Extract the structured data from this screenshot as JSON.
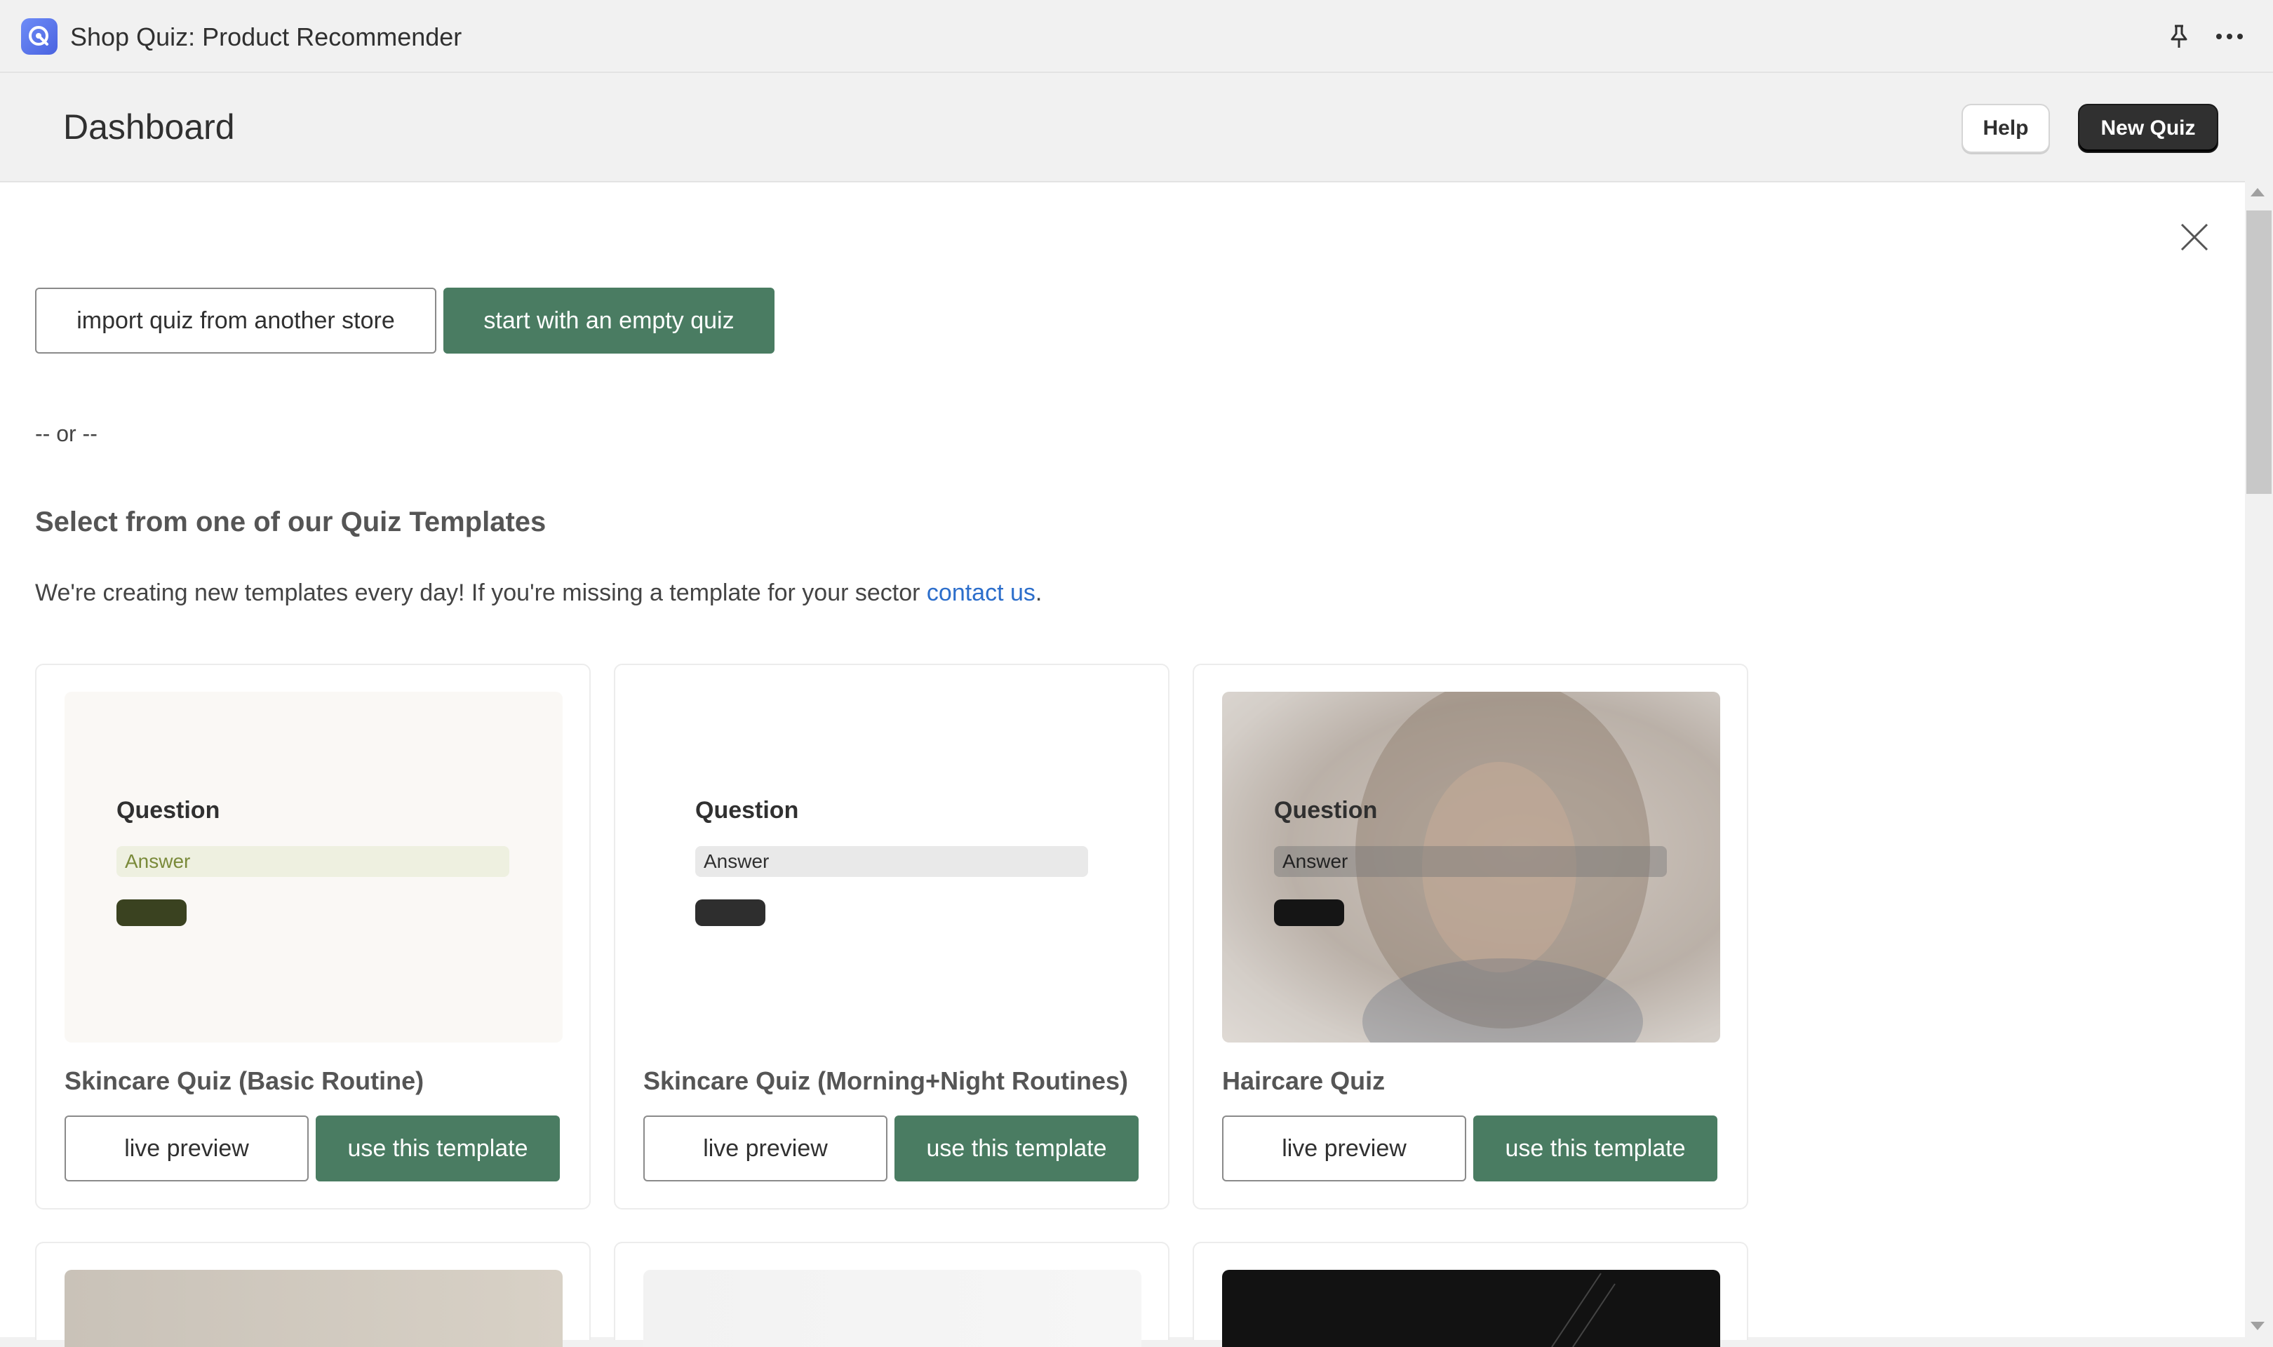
{
  "app": {
    "title": "Shop Quiz: Product Recommender"
  },
  "header": {
    "title": "Dashboard",
    "help_label": "Help",
    "new_quiz_label": "New Quiz"
  },
  "modal": {
    "import_label": "import quiz from another store",
    "empty_label": "start with an empty quiz",
    "or_text": "-- or --",
    "section_title": "Select from one of our Quiz Templates",
    "section_desc": "We're creating new templates every day! If you're missing a template for your sector ",
    "contact_link": "contact us",
    "section_desc_end": "."
  },
  "templates": [
    {
      "title": "Skincare Quiz (Basic Routine)",
      "question": "Question",
      "answer": "Answer",
      "preview_label": "live preview",
      "use_label": "use this template",
      "colors": {
        "bg": "#faf8f5",
        "answer_bg": "#eef0e0",
        "answer_text": "#7a8a3a",
        "button": "#3a4220"
      }
    },
    {
      "title": "Skincare Quiz (Morning+Night Routines)",
      "question": "Question",
      "answer": "Answer",
      "preview_label": "live preview",
      "use_label": "use this template",
      "colors": {
        "bg": "#ffffff",
        "answer_bg": "#e9e9e9",
        "answer_text": "#303030",
        "button": "#2e2e2e"
      }
    },
    {
      "title": "Haircare Quiz",
      "question": "Question",
      "answer": "Answer",
      "preview_label": "live preview",
      "use_label": "use this template",
      "colors": {
        "bg": "#d8d2cc",
        "answer_bg": "rgba(120,120,120,0.45)",
        "answer_text": "#222222",
        "button": "#151515"
      }
    }
  ],
  "colors": {
    "accent_green": "#4a7c62",
    "link": "#2c6ecb",
    "dark_button": "#303030"
  },
  "icons": {
    "logo": "app-logo-icon",
    "pin": "pin-icon",
    "more": "more-icon",
    "close": "close-icon"
  }
}
